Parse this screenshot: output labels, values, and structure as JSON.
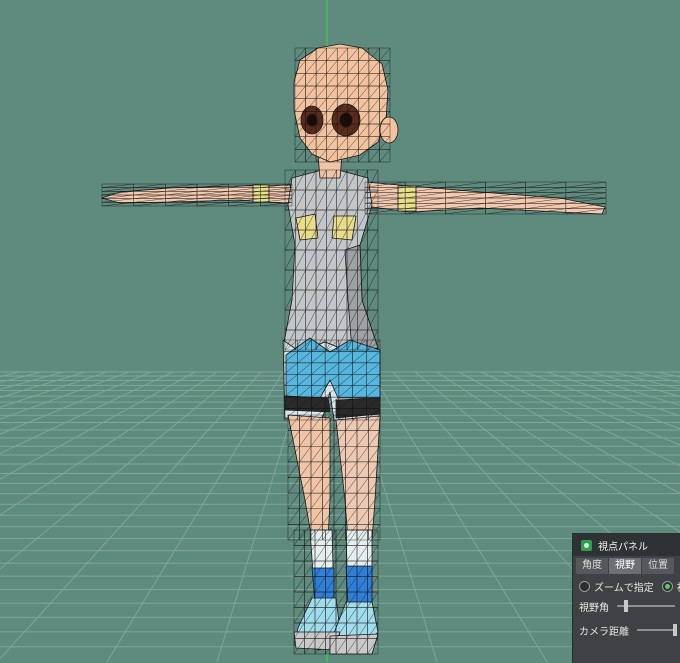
{
  "viewport": {
    "background": "#5f8a7e",
    "grid_color": "#7fa599",
    "axis_color": "#34d04a",
    "model": "anime girl character, wireframe T-pose"
  },
  "panel": {
    "title": "視点パネル",
    "tabs": [
      {
        "label": "角度",
        "active": false
      },
      {
        "label": "視野",
        "active": true
      },
      {
        "label": "位置",
        "active": false
      }
    ],
    "zoom_option": "ズームで指定",
    "view_option": "視",
    "fov_label": "視野角",
    "fov_value": 0.12,
    "camera_distance_label": "カメラ距離",
    "camera_distance_value": 0.95
  }
}
